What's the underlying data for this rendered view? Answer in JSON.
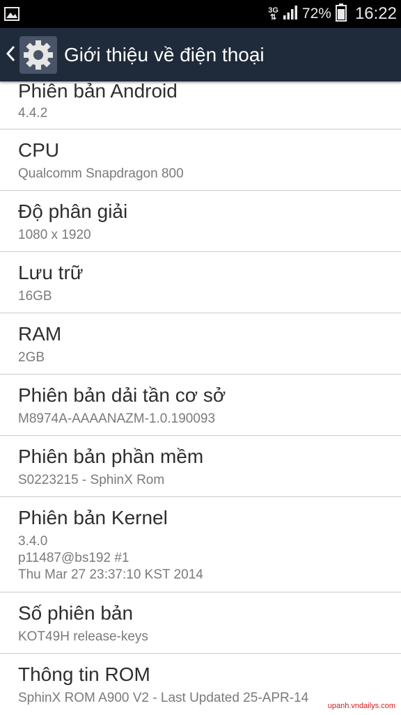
{
  "status_bar": {
    "network_type": "3G",
    "battery_percent": "72%",
    "time": "16:22",
    "icons": [
      "image-notification-icon",
      "data-arrows-icon",
      "signal-icon",
      "battery-icon"
    ]
  },
  "action_bar": {
    "title": "Giới thiệu về điện thoại",
    "icons": [
      "back-chevron-icon",
      "settings-gear-icon"
    ]
  },
  "items": [
    {
      "title": "Phiên bản Android",
      "value": "4.4.2"
    },
    {
      "title": "CPU",
      "value": "Qualcomm Snapdragon 800"
    },
    {
      "title": "Độ phân giải",
      "value": "1080 x 1920"
    },
    {
      "title": "Lưu trữ",
      "value": "16GB"
    },
    {
      "title": "RAM",
      "value": "2GB"
    },
    {
      "title": "Phiên bản dải tần cơ sở",
      "value": "M8974A-AAAANAZM-1.0.190093"
    },
    {
      "title": "Phiên bản phần mềm",
      "value": "S0223215 - SphinX Rom"
    },
    {
      "title": "Phiên bản Kernel",
      "value_lines": [
        "3.4.0",
        "p11487@bs192 #1",
        "Thu Mar 27 23:37:10 KST 2014"
      ]
    },
    {
      "title": "Số phiên bản",
      "value": "KOT49H release-keys"
    },
    {
      "title": "Thông tin ROM",
      "value": "SphinX ROM A900 V2 - Last Updated 25-APR-14"
    }
  ],
  "watermark": "upanh.vndailys.com",
  "colors": {
    "status_bar_bg": "#000000",
    "action_bar_bg": "#1f2a3a",
    "list_bg": "#ffffff",
    "title_text": "#2e2e2e",
    "sub_text": "#7a7a7a",
    "divider": "#c9c9c9",
    "watermark": "#d21c1c"
  }
}
